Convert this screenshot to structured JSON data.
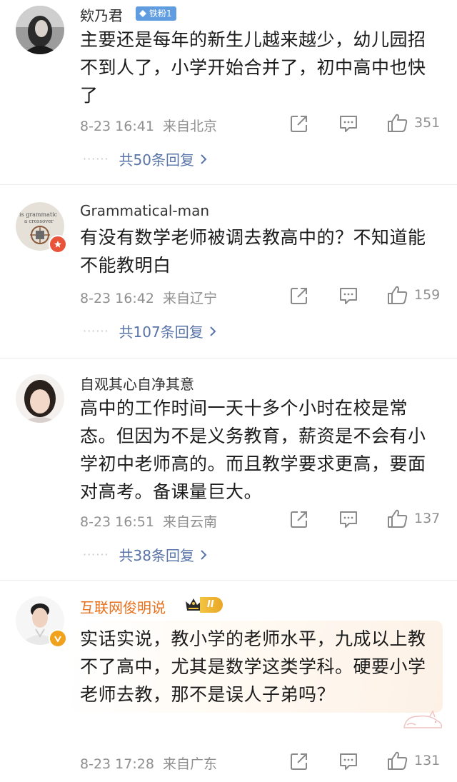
{
  "comments": [
    {
      "username": "欸乃君",
      "badge": "铁粉1",
      "text": "主要还是每年的新生儿越来越少，幼儿园招不到人了，小学开始合并了，初中高中也快了",
      "time": "8-23 16:41",
      "location": "来自北京",
      "likes": "351",
      "replies": "共50条回复"
    },
    {
      "username": "Grammatical-man",
      "text": "有没有数学老师被调去教高中的？不知道能不能教明白",
      "time": "8-23 16:42",
      "location": "来自辽宁",
      "likes": "159",
      "replies": "共107条回复",
      "avatar_text_1": "is grammatic",
      "avatar_text_2": "a crossover"
    },
    {
      "username": "自观其心自净其意",
      "text": "高中的工作时间一天十多个小时在校是常态。但因为不是义务教育，薪资是不会有小学初中老师高的。而且教学要求更高，要面对高考。备课量巨大。",
      "time": "8-23 16:51",
      "location": "来自云南",
      "likes": "137",
      "replies": "共38条回复"
    },
    {
      "username": "互联网俊明说",
      "vip_level": "II",
      "text": "实话实说，教小学的老师水平，九成以上教不了高中，尤其是数学这类学科。硬要小学老师去教，那不是误人子弟吗？",
      "time": "8-23 17:28",
      "location": "来自广东",
      "likes": "131"
    }
  ],
  "icons": {
    "share": "share-icon",
    "comment": "comment-icon",
    "like": "thumbs-up-icon",
    "chevron": "chevron-right-icon"
  },
  "colors": {
    "link": "#5874a8",
    "meta": "#8f8f8f",
    "vip_name": "#e8701b",
    "badge": "#5f9ce0"
  }
}
